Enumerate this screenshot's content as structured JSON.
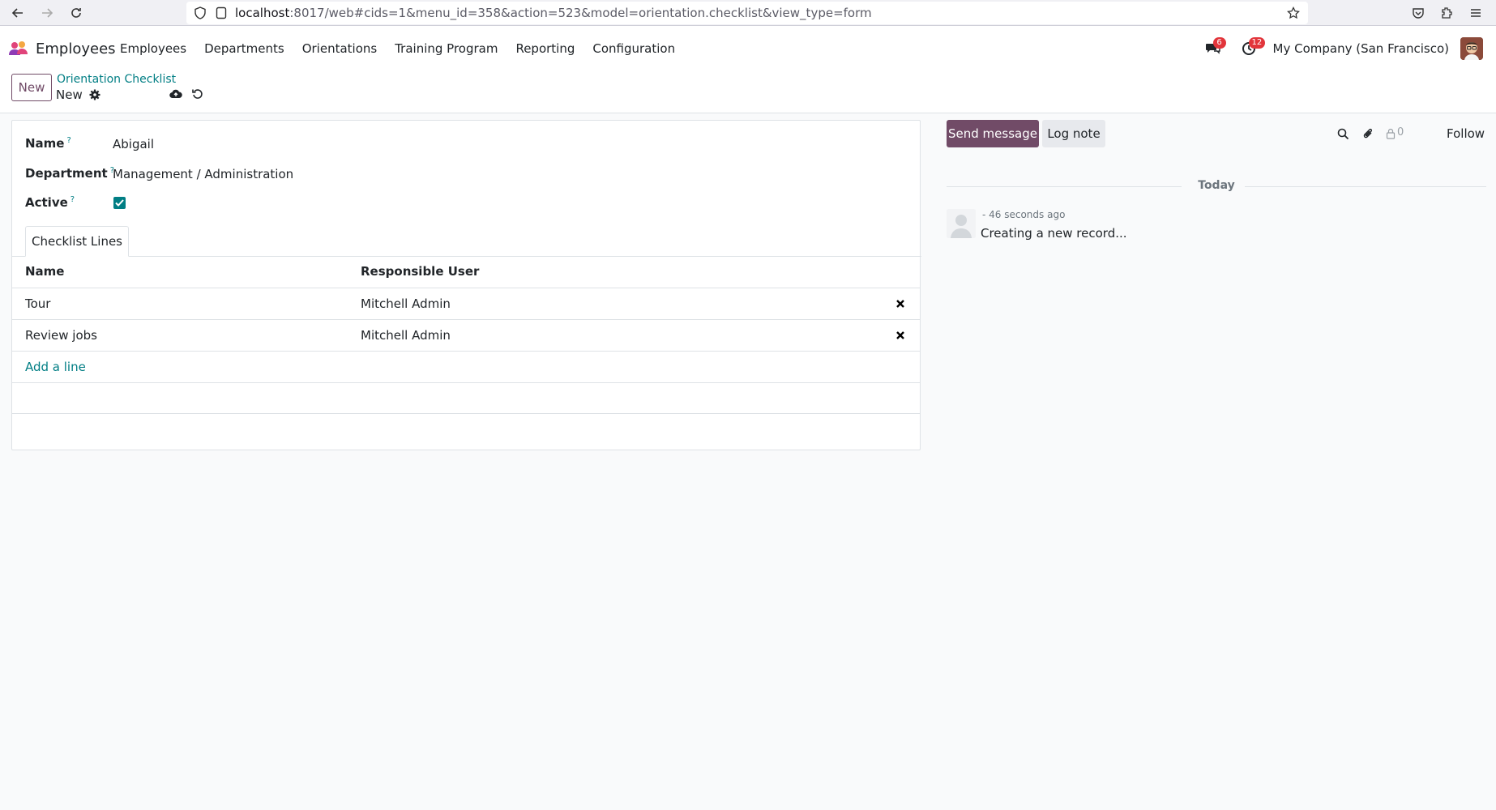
{
  "browser": {
    "url_host": "localhost",
    "url_rest": ":8017/web#cids=1&menu_id=358&action=523&model=orientation.checklist&view_type=form"
  },
  "navbar": {
    "app_name": "Employees",
    "menu": [
      "Employees",
      "Departments",
      "Orientations",
      "Training Program",
      "Reporting",
      "Configuration"
    ],
    "messages_badge": "6",
    "activities_badge": "12",
    "company": "My Company (San Francisco)"
  },
  "control_panel": {
    "new_button": "New",
    "breadcrumb": "Orientation Checklist",
    "record_title": "New"
  },
  "form": {
    "name_label": "Name",
    "name_value": "Abigail",
    "department_label": "Department",
    "department_value": "Management / Administration",
    "active_label": "Active",
    "active_checked": true,
    "help_mark": "?",
    "tab_label": "Checklist Lines",
    "columns": [
      "Name",
      "Responsible User"
    ],
    "lines": [
      {
        "name": "Tour",
        "user": "Mitchell Admin"
      },
      {
        "name": "Review jobs",
        "user": "Mitchell Admin"
      }
    ],
    "add_line": "Add a line"
  },
  "chatter": {
    "send_message": "Send message",
    "log_note": "Log note",
    "follower_count": "0",
    "follow": "Follow",
    "day": "Today",
    "message_meta": "- 46 seconds ago",
    "message_body": "Creating a new record..."
  },
  "colors": {
    "primary": "#714b67",
    "accent": "#017e84",
    "badge": "#e2353b"
  }
}
